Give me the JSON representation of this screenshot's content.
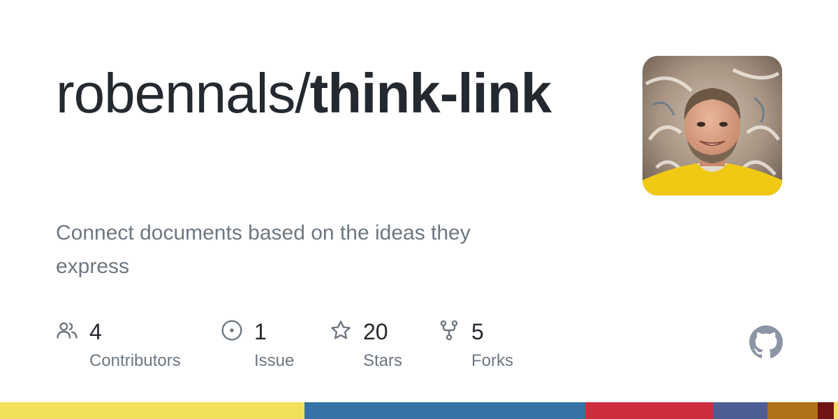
{
  "repo": {
    "owner": "robennals/",
    "name": "think-link",
    "description": "Connect documents based on the ideas they express"
  },
  "stats": {
    "contributors": {
      "value": "4",
      "label": "Contributors",
      "icon": "people-icon"
    },
    "issues": {
      "value": "1",
      "label": "Issue",
      "icon": "issue-icon"
    },
    "stars": {
      "value": "20",
      "label": "Stars",
      "icon": "star-icon"
    },
    "forks": {
      "value": "5",
      "label": "Forks",
      "icon": "fork-icon"
    }
  },
  "colors": {
    "text": "#24292f",
    "muted": "#6e7781",
    "icon": "#6e7781",
    "logo": "#8c95a6"
  },
  "language_bar": [
    {
      "color": "#f1e05a",
      "share": 36.3
    },
    {
      "color": "#3572A5",
      "share": 33.5
    },
    {
      "color": "#cc2e3e",
      "share": 15.3
    },
    {
      "color": "#4F5D95",
      "share": 6.5
    },
    {
      "color": "#b07219",
      "share": 6.0
    },
    {
      "color": "#701516",
      "share": 1.9
    },
    {
      "color": "#f1e05a",
      "share": 0.5
    }
  ]
}
